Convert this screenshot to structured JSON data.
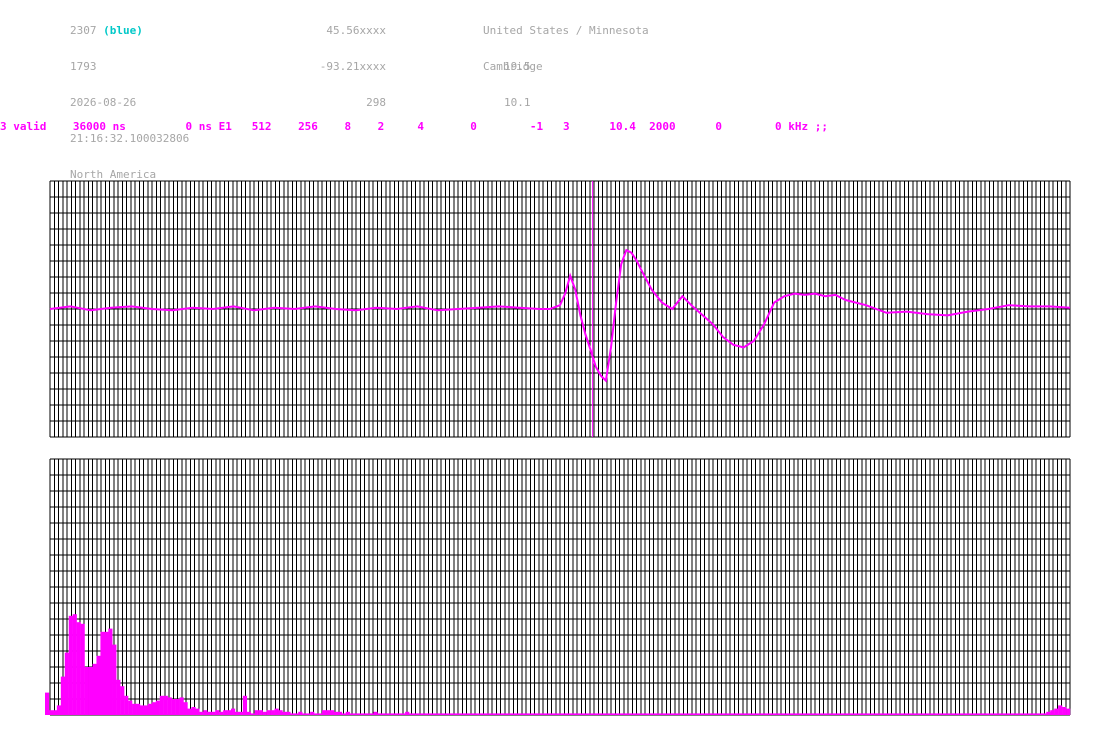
{
  "station": {
    "id": "2307",
    "color_label": "(blue)",
    "number": "1793",
    "date": "2026-08-26",
    "time": "21:16:32.100032806",
    "region": "North America",
    "lat": "45.56xxxx",
    "lon": "-93.21xxxx",
    "alt": "298",
    "country": "United States / Minnesota",
    "city": "Cambridge",
    "value_a": "19.5",
    "value_b": "10.1"
  },
  "params": {
    "valid": "3 valid",
    "window": "36000 ns",
    "offset": "0 ns E1",
    "p1": "512",
    "p2": "256",
    "p3": "8",
    "p4": "2",
    "p5": "4",
    "p6": "0",
    "p7": "-1",
    "p8": "3",
    "p9": "10.4",
    "p10": "2000",
    "p11": "0",
    "freq": "0 kHz ;;"
  },
  "colors": {
    "signal": "#ff00ff",
    "grid": "#000000",
    "marker": "#ff00ff",
    "header": "#a6a6a6",
    "accent": "#00c8c8"
  },
  "chart_data": [
    {
      "type": "line",
      "title": "",
      "xlim": [
        0,
        100
      ],
      "ylim": [
        -1,
        1
      ],
      "grid": true,
      "marker_x": 53.2,
      "series": [
        {
          "x": [
            0,
            2,
            4,
            6,
            8,
            10,
            12,
            14,
            16,
            18,
            20,
            22,
            24,
            26,
            28,
            30,
            32,
            34,
            36,
            38,
            40,
            42,
            44,
            46,
            48,
            49,
            50,
            50.5,
            51,
            51.5,
            52,
            52.5,
            53,
            53.5,
            54,
            54.5,
            55,
            55.5,
            56,
            56.5,
            57,
            57.5,
            58,
            59,
            60,
            61,
            62,
            63,
            64,
            65,
            66,
            67,
            68,
            69,
            70,
            71,
            72,
            73,
            74,
            75,
            76,
            77,
            78,
            80,
            82,
            84,
            86,
            88,
            90,
            92,
            94,
            96,
            98,
            100
          ],
          "y": [
            0.0,
            0.02,
            -0.01,
            0.01,
            0.02,
            0.0,
            -0.01,
            0.01,
            0.0,
            0.02,
            -0.01,
            0.01,
            0.0,
            0.02,
            0.0,
            -0.01,
            0.01,
            0.0,
            0.02,
            -0.01,
            0.0,
            0.01,
            0.02,
            0.01,
            0.0,
            0.0,
            0.03,
            0.12,
            0.26,
            0.15,
            -0.05,
            -0.2,
            -0.32,
            -0.45,
            -0.52,
            -0.56,
            -0.3,
            0.05,
            0.35,
            0.46,
            0.44,
            0.38,
            0.3,
            0.15,
            0.05,
            0.0,
            0.1,
            0.02,
            -0.05,
            -0.12,
            -0.22,
            -0.28,
            -0.3,
            -0.25,
            -0.12,
            0.05,
            0.1,
            0.12,
            0.11,
            0.12,
            0.1,
            0.11,
            0.07,
            0.03,
            -0.03,
            -0.02,
            -0.04,
            -0.05,
            -0.02,
            0.0,
            0.03,
            0.02,
            0.02,
            0.01
          ]
        }
      ]
    },
    {
      "type": "bar",
      "title": "",
      "ylim": [
        0,
        16
      ],
      "grid": true,
      "values": [
        1.4,
        0.3,
        0.3,
        0.6,
        2.4,
        3.9,
        6.2,
        6.3,
        5.8,
        5.7,
        3.0,
        3.0,
        3.2,
        3.7,
        5.2,
        5.2,
        5.4,
        4.4,
        2.2,
        1.8,
        1.2,
        0.9,
        0.7,
        0.7,
        0.6,
        0.6,
        0.7,
        0.8,
        0.9,
        1.2,
        1.2,
        1.1,
        1.0,
        1.0,
        1.1,
        0.8,
        0.4,
        0.5,
        0.4,
        0.2,
        0.3,
        0.2,
        0.2,
        0.3,
        0.2,
        0.3,
        0.3,
        0.4,
        0.2,
        0.2,
        1.2,
        0.2,
        0.1,
        0.3,
        0.3,
        0.2,
        0.3,
        0.3,
        0.4,
        0.3,
        0.2,
        0.2,
        0.1,
        0.1,
        0.2,
        0.1,
        0.1,
        0.2,
        0.1,
        0.1,
        0.3,
        0.3,
        0.3,
        0.2,
        0.2,
        0.1,
        0.2,
        0.1,
        0.1,
        0.1,
        0.1,
        0.1,
        0.1,
        0.2,
        0.1,
        0.1,
        0.1,
        0.1,
        0.1,
        0.1,
        0.1,
        0.2,
        0.1,
        0.1,
        0.1,
        0.1,
        0.1,
        0.1,
        0.1,
        0.1,
        0.1,
        0.1,
        0.1,
        0.1,
        0.1,
        0.1,
        0.1,
        0.1,
        0.1,
        0.1,
        0.1,
        0.1,
        0.1,
        0.1,
        0.1,
        0.1,
        0.1,
        0.1,
        0.1,
        0.1,
        0.1,
        0.1,
        0.1,
        0.1,
        0.1,
        0.1,
        0.1,
        0.1,
        0.1,
        0.1,
        0.1,
        0.1,
        0.1,
        0.1,
        0.1,
        0.1,
        0.1,
        0.1,
        0.1,
        0.1,
        0.1,
        0.1,
        0.1,
        0.1,
        0.1,
        0.1,
        0.1,
        0.1,
        0.1,
        0.1,
        0.1,
        0.1,
        0.1,
        0.1,
        0.1,
        0.1,
        0.1,
        0.1,
        0.1,
        0.1,
        0.1,
        0.1,
        0.1,
        0.1,
        0.1,
        0.1,
        0.1,
        0.1,
        0.1,
        0.1,
        0.1,
        0.1,
        0.1,
        0.1,
        0.1,
        0.1,
        0.1,
        0.1,
        0.1,
        0.1,
        0.1,
        0.1,
        0.1,
        0.1,
        0.1,
        0.1,
        0.1,
        0.1,
        0.1,
        0.1,
        0.1,
        0.1,
        0.1,
        0.1,
        0.1,
        0.1,
        0.1,
        0.1,
        0.1,
        0.1,
        0.1,
        0.1,
        0.1,
        0.1,
        0.1,
        0.1,
        0.1,
        0.1,
        0.1,
        0.1,
        0.1,
        0.1,
        0.1,
        0.1,
        0.1,
        0.1,
        0.1,
        0.1,
        0.1,
        0.1,
        0.1,
        0.1,
        0.1,
        0.1,
        0.1,
        0.1,
        0.1,
        0.1,
        0.1,
        0.1,
        0.1,
        0.1,
        0.1,
        0.1,
        0.1,
        0.1,
        0.1,
        0.1,
        0.1,
        0.1,
        0.1,
        0.1,
        0.1,
        0.1,
        0.1,
        0.1,
        0.1,
        0.1,
        0.1,
        0.1,
        0.1,
        0.1,
        0.1,
        0.2,
        0.3,
        0.4,
        0.6,
        0.5,
        0.4
      ]
    }
  ]
}
